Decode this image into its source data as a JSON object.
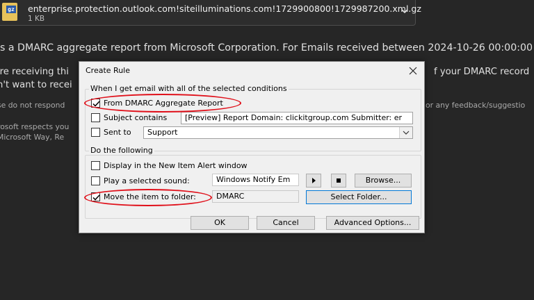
{
  "attachment": {
    "icon_letters": "gz",
    "filename": "enterprise.protection.outlook.com!siteilluminations.com!1729900800!1729987200.xml.gz",
    "size": "1 KB"
  },
  "email": {
    "line1": "is a DMARC aggregate report from Microsoft Corporation. For Emails received between 2024-10-26 00:00:00",
    "line2_left": "'re receiving thi",
    "line2_right": "f your DMARC record",
    "line3": "n't want to recei",
    "line4_left": "se do not respond",
    "line4_right": "or any feedback/suggestio",
    "line5": "rosoft respects you",
    "line6": "Microsoft Way, Re"
  },
  "dialog": {
    "title": "Create Rule",
    "group1_label": "When I get email with all of the selected conditions",
    "conditions": [
      {
        "label": "From DMARC Aggregate Report",
        "checked": true
      },
      {
        "label": "Subject contains",
        "checked": false,
        "value": "[Preview] Report Domain: clickitgroup.com Submitter: er"
      },
      {
        "label": "Sent to",
        "checked": false,
        "value": "Support"
      }
    ],
    "group2_label": "Do the following",
    "actions": [
      {
        "label": "Display in the New Item Alert window",
        "checked": false
      },
      {
        "label": "Play a selected sound:",
        "checked": false,
        "value": "Windows Notify Em",
        "browse_label": "Browse..."
      },
      {
        "label": "Move the item to folder:",
        "checked": true,
        "value": "DMARC",
        "select_label": "Select Folder..."
      }
    ],
    "ok_label": "OK",
    "cancel_label": "Cancel",
    "advanced_label": "Advanced Options...",
    "highlight_color": "#e0101a"
  }
}
